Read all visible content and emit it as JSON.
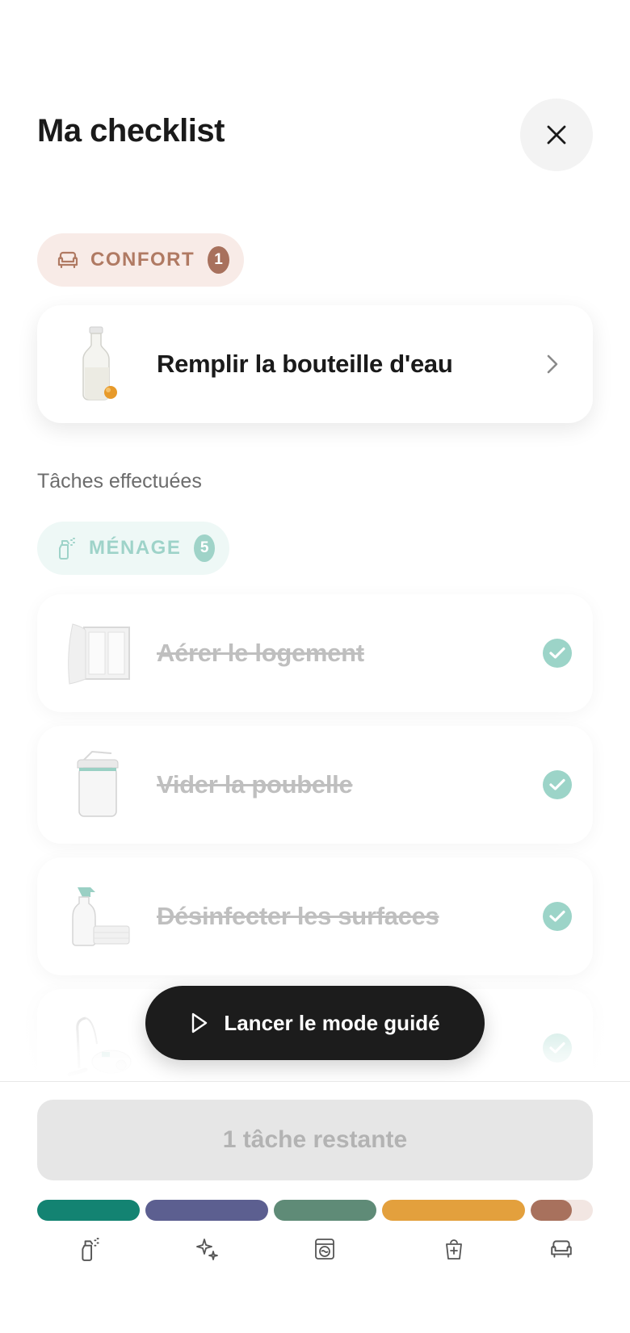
{
  "header": {
    "title": "Ma checklist",
    "close_icon": "close-icon"
  },
  "pending": {
    "category": {
      "label": "CONFORT",
      "count": "1",
      "icon": "armchair-icon",
      "color": "#a8715d"
    },
    "tasks": [
      {
        "label": "Remplir la bouteille d'eau",
        "image": "water-bottle",
        "action_icon": "chevron-right-icon"
      }
    ]
  },
  "completed": {
    "section_label": "Tâches effectuées",
    "category": {
      "label": "MÉNAGE",
      "count": "5",
      "icon": "spray-bottle-icon",
      "color": "#9fd3c8"
    },
    "tasks": [
      {
        "label": "Aérer le logement",
        "image": "open-window",
        "status_icon": "check-circle-icon"
      },
      {
        "label": "Vider la poubelle",
        "image": "trash-bin",
        "status_icon": "check-circle-icon"
      },
      {
        "label": "Désinfecter les surfaces",
        "image": "spray-and-cloth",
        "status_icon": "check-circle-icon"
      },
      {
        "label": "",
        "image": "vacuum-cleaner",
        "status_icon": "check-circle-icon"
      }
    ]
  },
  "guided_mode": {
    "label": "Lancer le mode guidé",
    "icon": "play-icon"
  },
  "footer": {
    "remaining_label": "1 tâche restante",
    "progress": [
      {
        "category": "cleaning",
        "color": "#138372",
        "fill": 1
      },
      {
        "category": "sparkle",
        "color": "#5c5f90",
        "fill": 1
      },
      {
        "category": "laundry",
        "color": "#5f8b77",
        "fill": 1
      },
      {
        "category": "supplies",
        "color": "#e3a03d",
        "fill": 1
      },
      {
        "category": "comfort",
        "color": "#a8715d",
        "fill": 0.66
      }
    ],
    "nav_icons": [
      "spray-bottle-icon",
      "sparkles-icon",
      "washing-machine-icon",
      "supplies-bag-icon",
      "armchair-icon"
    ]
  }
}
